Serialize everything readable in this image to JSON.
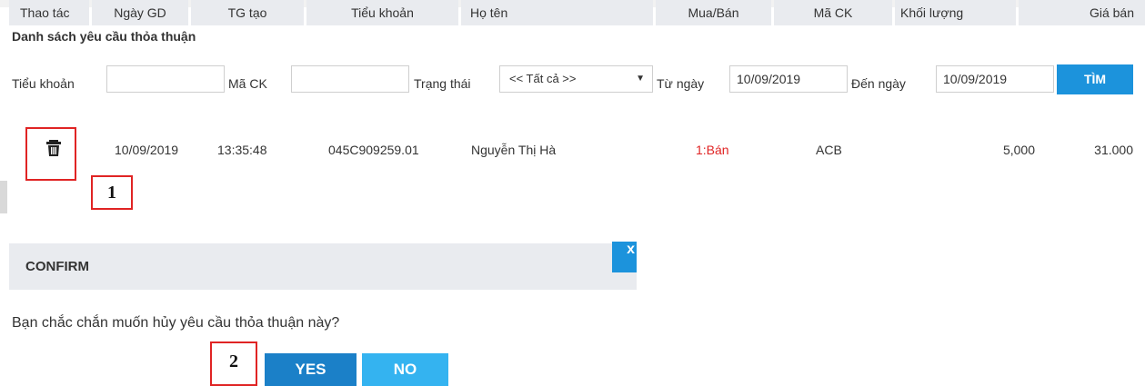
{
  "section_title": "Danh sách yêu cầu thỏa thuận",
  "filters": {
    "tieu_khoan_label": "Tiểu khoản",
    "tieu_khoan_value": "",
    "ma_ck_label": "Mã CK",
    "ma_ck_value": "",
    "trang_thai_label": "Trạng thái",
    "trang_thai_selected": "<< Tất cả >>",
    "tu_ngay_label": "Từ ngày",
    "tu_ngay_value": "10/09/2019",
    "den_ngay_label": "Đến ngày",
    "den_ngay_value": "10/09/2019",
    "search_button": "TÌM"
  },
  "table": {
    "headers": [
      "Thao tác",
      "Ngày GD",
      "TG tạo",
      "Tiểu khoản",
      "Họ tên",
      "Mua/Bán",
      "Mã CK",
      "Khối lượng",
      "Giá bán"
    ],
    "rows": [
      {
        "ngay_gd": "10/09/2019",
        "tg_tao": "13:35:48",
        "tieu_khoan": "045C909259.01",
        "ho_ten": "Nguyễn Thị Hà",
        "mua_ban": "1:Bán",
        "ma_ck": "ACB",
        "khoi_luong": "5,000",
        "gia_ban": "31.000"
      }
    ]
  },
  "annotations": {
    "step1": "1",
    "step2": "2"
  },
  "confirm_dialog": {
    "title": "CONFIRM",
    "close_glyph": "x",
    "message": "Bạn chắc chắn muốn hủy yêu cầu thỏa thuận này?",
    "yes_label": "YES",
    "no_label": "NO"
  },
  "colors": {
    "accent_blue": "#1c93dc",
    "sell_red": "#e02424",
    "header_gray": "#e9ebef"
  },
  "icons": {
    "delete": "trash-icon",
    "dropdown": "caret-down-icon"
  }
}
